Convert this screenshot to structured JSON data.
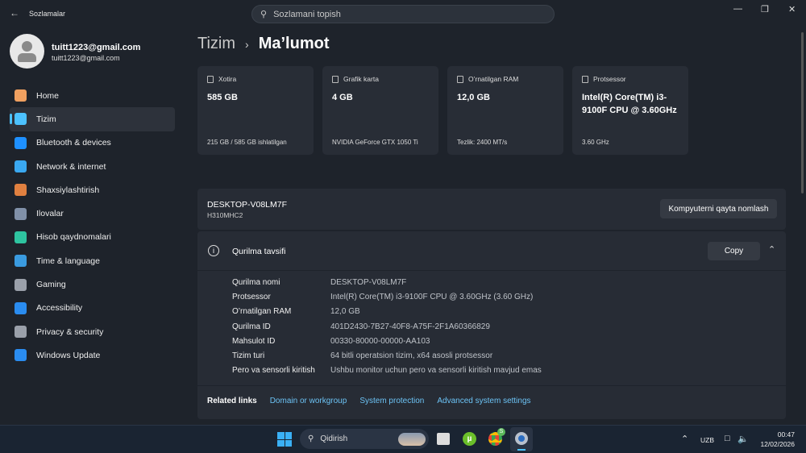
{
  "window": {
    "title": "Sozlamalar",
    "search_placeholder": "Sozlamani topish"
  },
  "user": {
    "name": "tuitt1223@gmail.com",
    "email": "tuitt1223@gmail.com"
  },
  "nav": [
    {
      "label": "Home",
      "icon": "home-icon",
      "color": "#f0a060"
    },
    {
      "label": "Tizim",
      "icon": "system-icon",
      "color": "#4cc2ff",
      "selected": true
    },
    {
      "label": "Bluetooth & devices",
      "icon": "bluetooth-icon",
      "color": "#1e90ff"
    },
    {
      "label": "Network & internet",
      "icon": "wifi-icon",
      "color": "#3aa8f0"
    },
    {
      "label": "Shaxsiylashtirish",
      "icon": "brush-icon",
      "color": "#e08040"
    },
    {
      "label": "Ilovalar",
      "icon": "apps-icon",
      "color": "#8090a8"
    },
    {
      "label": "Hisob qaydnomalari",
      "icon": "account-icon",
      "color": "#2ec4a0"
    },
    {
      "label": "Time & language",
      "icon": "clock-globe-icon",
      "color": "#3a9be0"
    },
    {
      "label": "Gaming",
      "icon": "gamepad-icon",
      "color": "#9aa0aa"
    },
    {
      "label": "Accessibility",
      "icon": "accessibility-icon",
      "color": "#2a8cf0"
    },
    {
      "label": "Privacy & security",
      "icon": "shield-icon",
      "color": "#9aa0aa"
    },
    {
      "label": "Windows Update",
      "icon": "update-icon",
      "color": "#2a8cf0"
    }
  ],
  "breadcrumb": {
    "parent": "Tizim",
    "current": "Ma’lumot"
  },
  "cards": [
    {
      "label": "Xotira",
      "value": "585 GB",
      "sub": "215 GB / 585 GB ishlatilgan"
    },
    {
      "label": "Grafik karta",
      "value": "4 GB",
      "sub": "NVIDIA GeForce GTX 1050 Ti"
    },
    {
      "label": "O’rnatilgan RAM",
      "value": "12,0 GB",
      "sub": "Tezlik: 2400 MT/s"
    },
    {
      "label": "Protsessor",
      "value": "Intel(R) Core(TM) i3-9100F CPU @ 3.60GHz",
      "sub": "3.60 GHz"
    }
  ],
  "device": {
    "name": "DESKTOP-V08LM7F",
    "model": "H310MHC2",
    "rename_label": "Kompyuterni qayta nomlash"
  },
  "specs": {
    "title": "Qurilma tavsifi",
    "copy_label": "Copy",
    "rows": [
      {
        "k": "Qurilma nomi",
        "v": "DESKTOP-V08LM7F"
      },
      {
        "k": "Protsessor",
        "v": "Intel(R) Core(TM) i3-9100F CPU @ 3.60GHz (3.60 GHz)"
      },
      {
        "k": "O’rnatilgan RAM",
        "v": "12,0 GB"
      },
      {
        "k": "Qurilma ID",
        "v": "401D2430-7B27-40F8-A75F-2F1A60366829"
      },
      {
        "k": "Mahsulot ID",
        "v": "00330-80000-00000-AA103"
      },
      {
        "k": "Tizim turi",
        "v": "64 bitli operatsion tizim, x64 asosli protsessor"
      },
      {
        "k": "Pero va sensorli kiritish",
        "v": "Ushbu monitor uchun pero va sensorli kiritish mavjud emas"
      }
    ]
  },
  "related": {
    "label": "Related links",
    "links": [
      "Domain or workgroup",
      "System protection",
      "Advanced system settings"
    ]
  },
  "taskbar": {
    "search": "Qidirish",
    "lang": "UZB",
    "time": "00:47",
    "date": "12/02/2026",
    "chrome_badge": "S"
  }
}
